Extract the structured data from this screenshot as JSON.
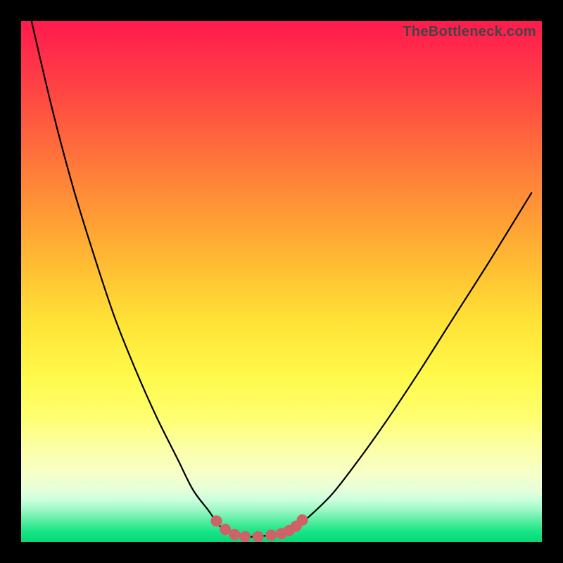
{
  "watermark": "TheBottleneck.com",
  "colors": {
    "frame_border": "#000000",
    "curve_stroke": "#000000",
    "marker_fill": "#cf6267",
    "marker_stroke": "#cf6267"
  },
  "chart_data": {
    "type": "line",
    "title": "",
    "xlabel": "",
    "ylabel": "",
    "xlim": [
      0,
      100
    ],
    "ylim": [
      0,
      100
    ],
    "grid": false,
    "legend": false,
    "series": [
      {
        "name": "bottleneck-curve",
        "x": [
          2,
          6,
          10,
          14,
          18,
          22,
          26,
          30,
          33,
          36,
          38,
          40,
          41.5,
          43,
          45,
          47,
          50,
          53,
          56,
          60,
          65,
          70,
          76,
          83,
          90,
          98
        ],
        "y": [
          100,
          83,
          68,
          55,
          43,
          33,
          24,
          16,
          10,
          6,
          3.2,
          1.8,
          1.2,
          1.0,
          1.0,
          1.2,
          1.6,
          3.0,
          5.5,
          9.5,
          16,
          23,
          32,
          43,
          54,
          67
        ]
      }
    ],
    "markers": {
      "name": "highlight-points",
      "x": [
        37.5,
        39.2,
        41,
        43,
        45.5,
        48,
        50,
        51.5,
        52.8,
        54
      ],
      "y": [
        4.0,
        2.4,
        1.4,
        1.0,
        1.0,
        1.3,
        1.6,
        2.2,
        3.0,
        4.2
      ]
    }
  }
}
